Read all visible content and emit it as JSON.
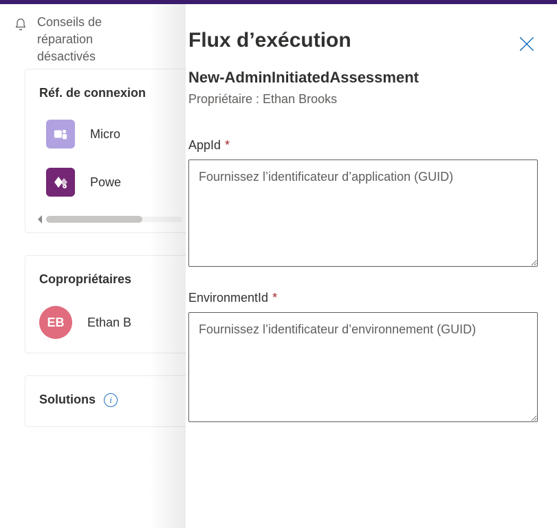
{
  "ribbon": {
    "message": "Conseils de réparation désactivés"
  },
  "cards": {
    "connections": {
      "title": "Réf. de connexion",
      "items": [
        {
          "label": "Micro"
        },
        {
          "label": "Powe"
        }
      ]
    },
    "coowners": {
      "title": "Copropriétaires",
      "owner": {
        "initials": "EB",
        "name": "Ethan B"
      }
    },
    "solutions": {
      "title": "Solutions"
    }
  },
  "panel": {
    "title": "Flux d’exécution",
    "flow_name": "New-AdminInitiatedAssessment",
    "owner_label": "Propriétaire : Ethan Brooks",
    "fields": {
      "appid": {
        "label": "AppId",
        "placeholder": "Fournissez l’identificateur d’application (GUID)",
        "value": ""
      },
      "envid": {
        "label": "EnvironmentId",
        "placeholder": "Fournissez l’identificateur d’environnement (GUID)",
        "value": ""
      }
    },
    "required_mark": "*"
  },
  "colors": {
    "accent": "#0f6cbd",
    "teams_tile": "#b1a1e0",
    "power_tile": "#742774",
    "avatar": "#e06c7d",
    "required": "#a4262c"
  }
}
